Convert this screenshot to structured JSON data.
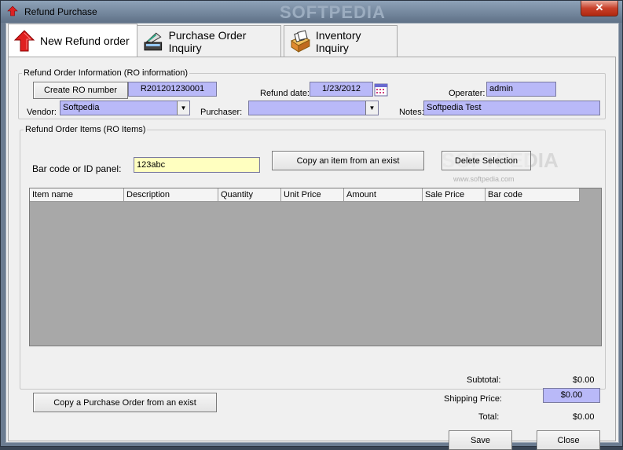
{
  "window": {
    "title": "Refund Purchase",
    "close_label": "✕"
  },
  "tabs": [
    {
      "label": "New Refund order",
      "active": true
    },
    {
      "label": "Purchase Order Inquiry"
    },
    {
      "label": "Inventory Inquiry"
    }
  ],
  "ro_info": {
    "legend": "Refund Order Information (RO information)",
    "create_button": "Create RO number",
    "ro_number": "R201201230001",
    "refund_date_label": "Refund date:",
    "refund_date": "1/23/2012",
    "operator_label": "Operater:",
    "operator": "admin",
    "vendor_label": "Vendor:",
    "vendor": "Softpedia",
    "purchaser_label": "Purchaser:",
    "purchaser": "",
    "notes_label": "Notes:",
    "notes": "Softpedia Test"
  },
  "ro_items": {
    "legend": "Refund Order Items (RO Items)",
    "barcode_label": "Bar code or ID panel:",
    "barcode_value": "123abc",
    "copy_item_button": "Copy an item from an exist",
    "delete_button": "Delete Selection",
    "columns": [
      "Item name",
      "Description",
      "Quantity",
      "Unit Price",
      "Amount",
      "Sale Price",
      "Bar code"
    ]
  },
  "totals": {
    "subtotal_label": "Subtotal:",
    "subtotal": "$0.00",
    "shipping_label": "Shipping Price:",
    "shipping": "$0.00",
    "total_label": "Total:",
    "total": "$0.00"
  },
  "footer": {
    "copy_po_button": "Copy a Purchase Order from an exist",
    "save_button": "Save",
    "close_button": "Close"
  },
  "watermark": {
    "title": "SOFTPEDIA",
    "url": "www.softpedia.com"
  }
}
